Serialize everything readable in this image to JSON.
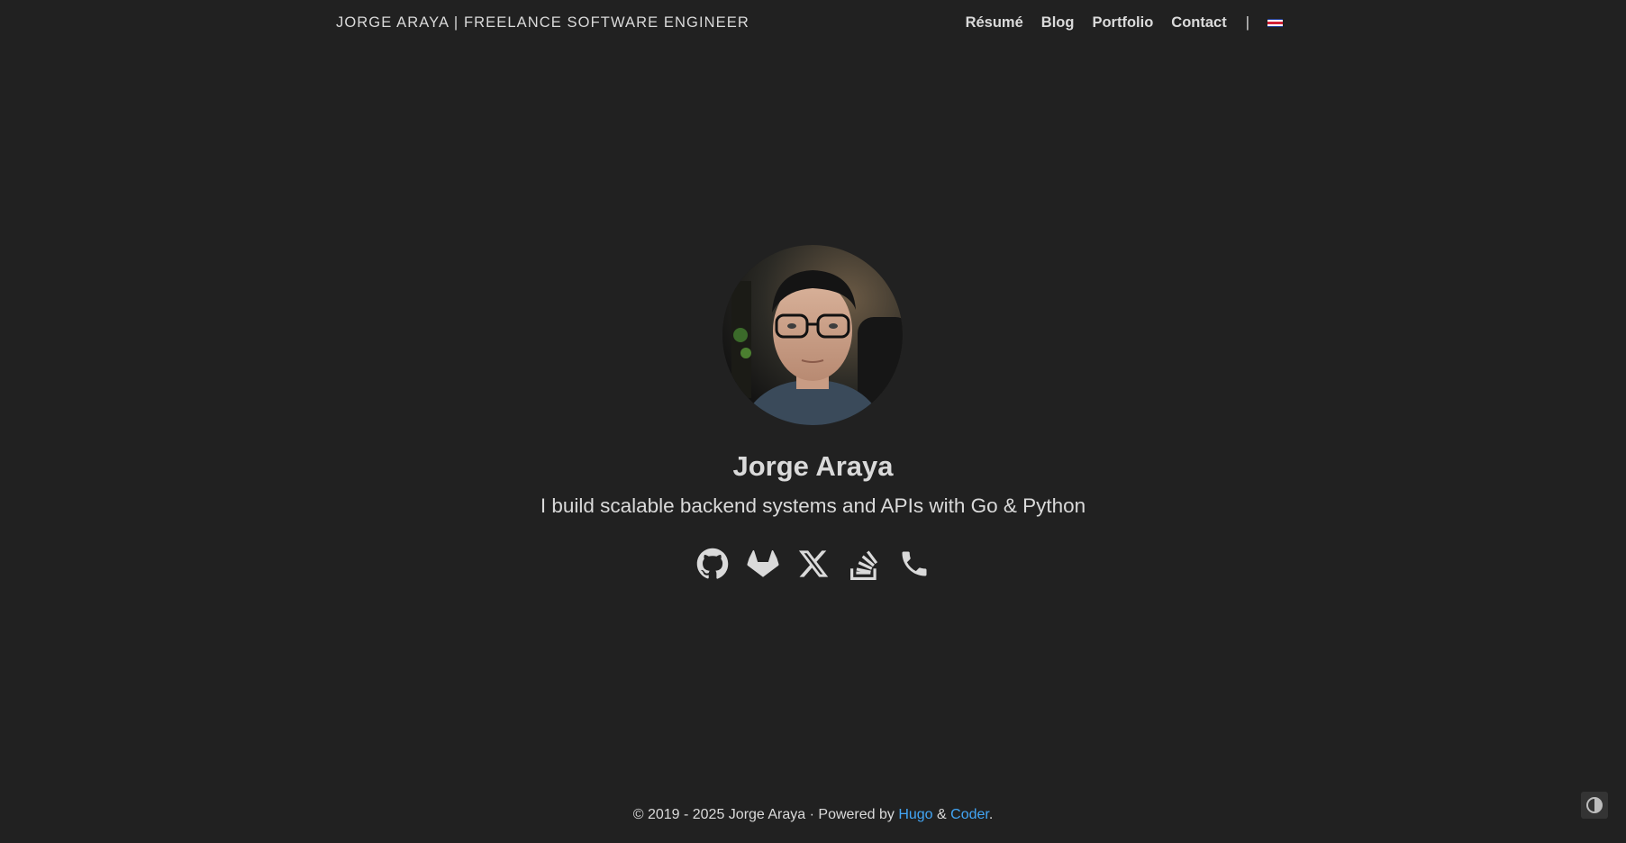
{
  "header": {
    "brand": "JORGE ARAYA | FREELANCE SOFTWARE ENGINEER",
    "nav": [
      {
        "label": "Résumé"
      },
      {
        "label": "Blog"
      },
      {
        "label": "Portfolio"
      },
      {
        "label": "Contact"
      }
    ],
    "separator": "|",
    "language_flag": "costa-rica-flag-icon"
  },
  "hero": {
    "avatar_icon": "profile-photo",
    "name": "Jorge Araya",
    "tagline": "I build scalable backend systems and APIs with Go & Python",
    "social_icons": [
      "github-icon",
      "gitlab-icon",
      "x-twitter-icon",
      "stackoverflow-icon",
      "phone-icon"
    ]
  },
  "footer": {
    "copyright": "© 2019 - 2025 Jorge Araya · Powered by ",
    "hugo_link": "Hugo",
    "amp": " & ",
    "coder_link": "Coder",
    "period": "."
  },
  "colors": {
    "background": "#212121",
    "text": "#dadada",
    "link": "#42a5f5"
  },
  "theme_toggle_icon": "contrast-toggle-icon"
}
